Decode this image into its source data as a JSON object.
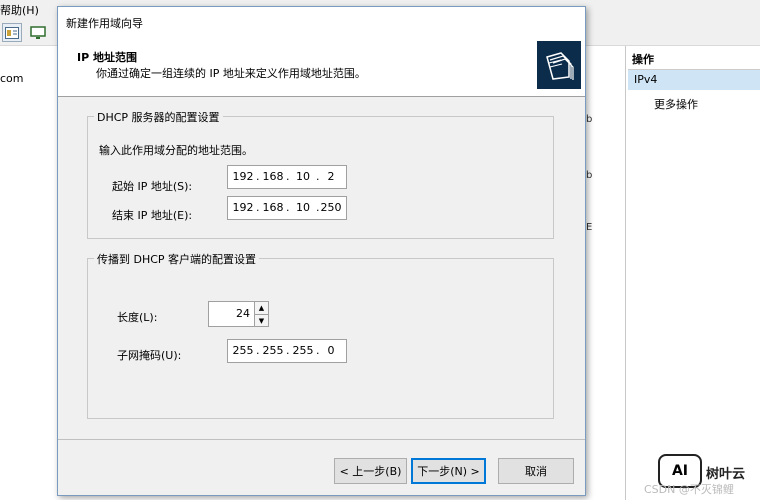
{
  "background": {
    "menu_help": "帮助(H)",
    "tree_text": "com",
    "center_fragments": [
      "b",
      "b",
      "E"
    ],
    "actions": {
      "header": "操作",
      "selected": "IPv4",
      "more": "更多操作"
    }
  },
  "dialog": {
    "title": "新建作用域向导",
    "header_title": "IP 地址范围",
    "header_subtitle": "你通过确定一组连续的 IP 地址来定义作用域地址范围。",
    "server_group": {
      "label": "DHCP 服务器的配置设置",
      "instruction": "输入此作用域分配的地址范围。",
      "start_label": "起始 IP 地址(S):",
      "start_ip": [
        "192",
        "168",
        "10",
        "2"
      ],
      "end_label": "结束 IP 地址(E):",
      "end_ip": [
        "192",
        "168",
        "10",
        "250"
      ]
    },
    "client_group": {
      "label": "传播到 DHCP 客户端的配置设置",
      "length_label": "长度(L):",
      "length_value": "24",
      "mask_label": "子网掩码(U):",
      "mask": [
        "255",
        "255",
        "255",
        "0"
      ]
    },
    "buttons": {
      "back": "< 上一步(B)",
      "next": "下一步(N) >",
      "cancel": "取消"
    }
  },
  "watermark": {
    "logo_text": "AI",
    "brand": "树叶云",
    "csdn": "CSDN @不灭锦鲤"
  },
  "colors": {
    "selection": "#cfe4f5",
    "focus_border": "#0078d7",
    "header_icon_bg": "#0b2c4a"
  }
}
